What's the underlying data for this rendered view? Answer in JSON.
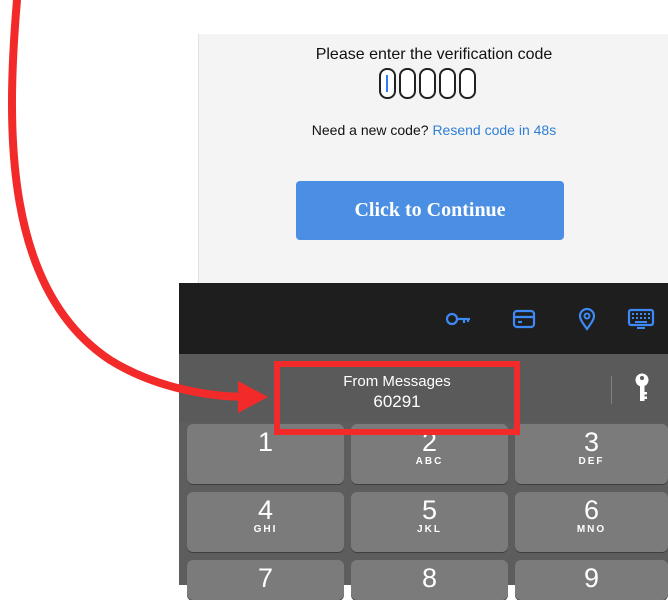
{
  "form": {
    "prompt": "Please enter the verification code",
    "code_length": 5,
    "resend_prefix": "Need a new code?",
    "resend_link": "Resend code in 48s",
    "continue_label": "Click to Continue"
  },
  "accessory_bar": {
    "icons": [
      "key-icon",
      "credit-card-icon",
      "location-pin-icon",
      "keyboard-icon"
    ]
  },
  "suggestion": {
    "source": "From Messages",
    "code": "60291"
  },
  "keypad": {
    "keys": [
      {
        "num": "1",
        "letters": ""
      },
      {
        "num": "2",
        "letters": "ABC"
      },
      {
        "num": "3",
        "letters": "DEF"
      },
      {
        "num": "4",
        "letters": "GHI"
      },
      {
        "num": "5",
        "letters": "JKL"
      },
      {
        "num": "6",
        "letters": "MNO"
      },
      {
        "num": "7",
        "letters": ""
      },
      {
        "num": "8",
        "letters": ""
      },
      {
        "num": "9",
        "letters": ""
      }
    ]
  },
  "colors": {
    "accent": "#4a8fe3",
    "link": "#2f7fd5",
    "highlight": "#f32a2a"
  }
}
